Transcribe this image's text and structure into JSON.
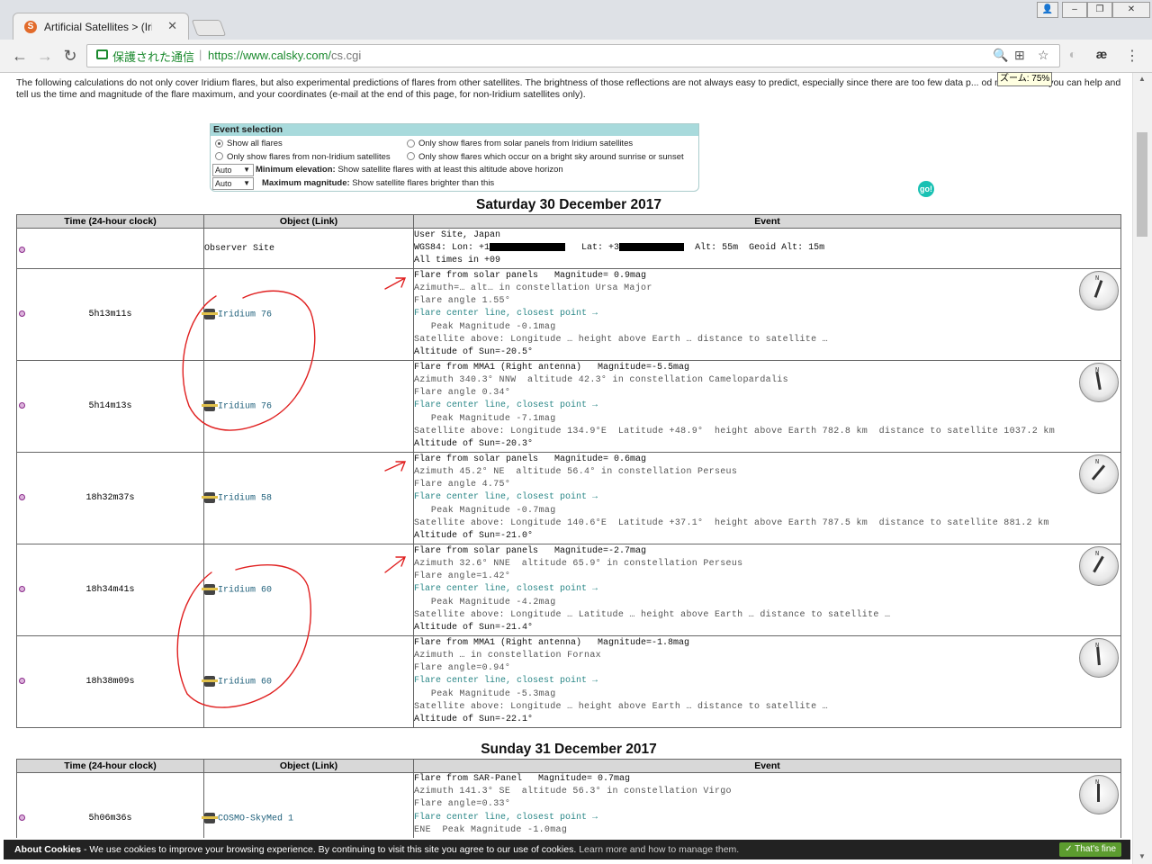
{
  "browser": {
    "tab_title": "Artificial Satellites > (Iridi",
    "secure_label": "保護された通信",
    "url_host": "https://www.calsky.com/",
    "url_path": "cs.cgi",
    "zoom_tooltip": "ズーム: 75%"
  },
  "page": {
    "intro": "The following calculations do not only cover Iridium flares, but also experimental predictions of flares from other satellites. The brightness of those reflections are not always easy to predict, especially since there are too few data p... od model. Here you can help and tell us the time and magnitude of the flare maximum, and your coordinates (e-mail at the end of this page, for non-Iridium satellites only).",
    "event_selection": {
      "title": "Event selection",
      "opt_all": "Show all flares",
      "opt_solar": "Only show flares from solar panels from Iridium satellites",
      "opt_non_iridium": "Only show flares from non-Iridium satellites",
      "opt_bright_sky": "Only show flares which occur on a bright sky around sunrise or sunset",
      "min_elev_value": "Auto",
      "min_elev_label": "Minimum elevation:",
      "min_elev_desc": "Show satellite flares with at least this altitude above horizon",
      "max_mag_value": "Auto",
      "max_mag_label": "Maximum magnitude:",
      "max_mag_desc": "Show satellite flares brighter than this",
      "go_label": "go!"
    },
    "headers": {
      "time": "Time (24-hour clock)",
      "object": "Object (Link)",
      "event": "Event"
    },
    "day1": {
      "title": "Saturday 30 December 2017",
      "observer": {
        "object": "Observer Site",
        "line1": "User Site, Japan",
        "line2a": "WGS84: Lon: +1",
        "line2b": "Lat: +3",
        "line2c": "Alt: 55m  Geoid Alt: 15m",
        "line3": "All times in +09"
      },
      "rows": [
        {
          "time": "5h13m11s",
          "object": "Iridium 76",
          "lines": [
            "Flare from solar panels   Magnitude= 0.9mag",
            "Azimuth=… alt… in constellation Ursa Major",
            "Flare angle 1.55°",
            "Flare center line, closest point →",
            "   Peak Magnitude -0.1mag",
            "Satellite above: Longitude … height above Earth … distance to satellite …",
            "Altitude of Sun=-20.5°"
          ]
        },
        {
          "time": "5h14m13s",
          "object": "Iridium 76",
          "lines": [
            "Flare from MMA1 (Right antenna)   Magnitude=-5.5mag",
            "Azimuth 340.3° NNW  altitude 42.3° in constellation Camelopardalis",
            "Flare angle 0.34°",
            "Flare center line, closest point →",
            "   Peak Magnitude -7.1mag",
            "Satellite above: Longitude 134.9°E  Latitude +48.9°  height above Earth 782.8 km  distance to satellite 1037.2 km",
            "Altitude of Sun=-20.3°"
          ]
        },
        {
          "time": "18h32m37s",
          "object": "Iridium 58",
          "lines": [
            "Flare from solar panels   Magnitude= 0.6mag",
            "Azimuth 45.2° NE  altitude 56.4° in constellation Perseus",
            "Flare angle 4.75°",
            "Flare center line, closest point →",
            "   Peak Magnitude -0.7mag",
            "Satellite above: Longitude 140.6°E  Latitude +37.1°  height above Earth 787.5 km  distance to satellite 881.2 km",
            "Altitude of Sun=-21.0°"
          ]
        },
        {
          "time": "18h34m41s",
          "object": "Iridium 60",
          "lines": [
            "Flare from solar panels   Magnitude=-2.7mag",
            "Azimuth 32.6° NNE  altitude 65.9° in constellation Perseus",
            "Flare angle=1.42°",
            "Flare center line, closest point →",
            "   Peak Magnitude -4.2mag",
            "Satellite above: Longitude … Latitude … height above Earth … distance to satellite …",
            "Altitude of Sun=-21.4°"
          ]
        },
        {
          "time": "18h38m09s",
          "object": "Iridium 60",
          "lines": [
            "Flare from MMA1 (Right antenna)   Magnitude=-1.8mag",
            "Azimuth … in constellation Fornax",
            "Flare angle=0.94°",
            "Flare center line, closest point →",
            "   Peak Magnitude -5.3mag",
            "Satellite above: Longitude … height above Earth … distance to satellite …",
            "Altitude of Sun=-22.1°"
          ]
        }
      ]
    },
    "day2": {
      "title": "Sunday 31 December 2017",
      "rows": [
        {
          "time": "5h06m36s",
          "object": "COSMO-SkyMed 1",
          "lines": [
            "Flare from SAR-Panel   Magnitude= 0.7mag",
            "Azimuth 141.3° SE  altitude 56.3° in constellation Virgo",
            "Flare angle=0.33°",
            "Flare center line, closest point →",
            "ENE  Peak Magnitude -1.0mag"
          ]
        }
      ]
    },
    "cookie": {
      "label": "About Cookies",
      "text": " - We use cookies to improve your browsing experience. By continuing to visit this site you agree to our use of cookies. ",
      "link": "Learn more and how to manage them.",
      "button": "✓ That's fine"
    }
  },
  "colors": {
    "header_teal": "#a8dadc",
    "secure_green": "#1b8a2e",
    "annotation_red": "#e02020"
  }
}
